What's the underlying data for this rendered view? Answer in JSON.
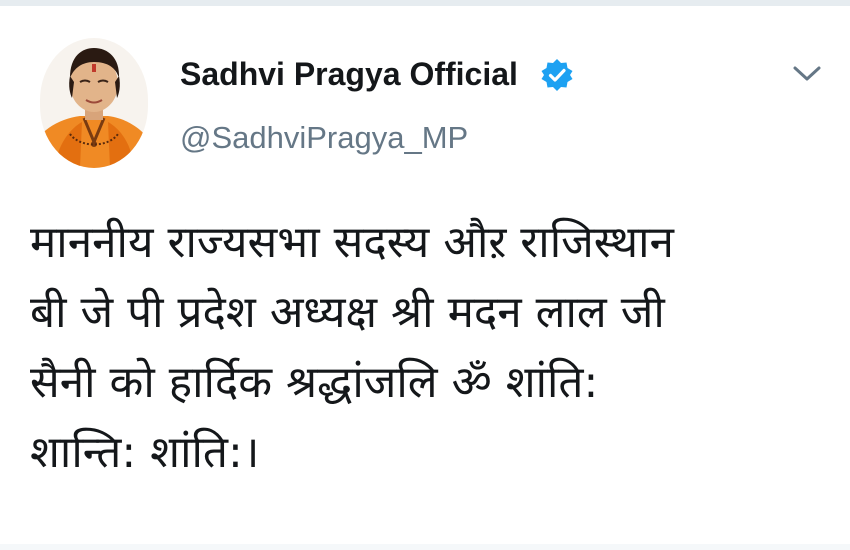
{
  "tweet": {
    "author": {
      "display_name": "Sadhvi Pragya Official",
      "handle": "@SadhviPragya_MP",
      "verified": true,
      "avatar_icon": "profile-photo"
    },
    "menu_icon": "chevron-down-icon",
    "text_lines": [
      "माननीय राज्यसभा सदस्य औऱ राजिस्थान",
      "बी जे पी प्रदेश अध्यक्ष श्री मदन लाल जी",
      "सैनी को हार्दिक श्रद्धांजलि ॐ शांति:",
      "शान्ति: शांति:।"
    ]
  },
  "colors": {
    "text": "#14171a",
    "handle": "#657786",
    "verified_badge": "#1da1f2",
    "caret": "#657786"
  }
}
